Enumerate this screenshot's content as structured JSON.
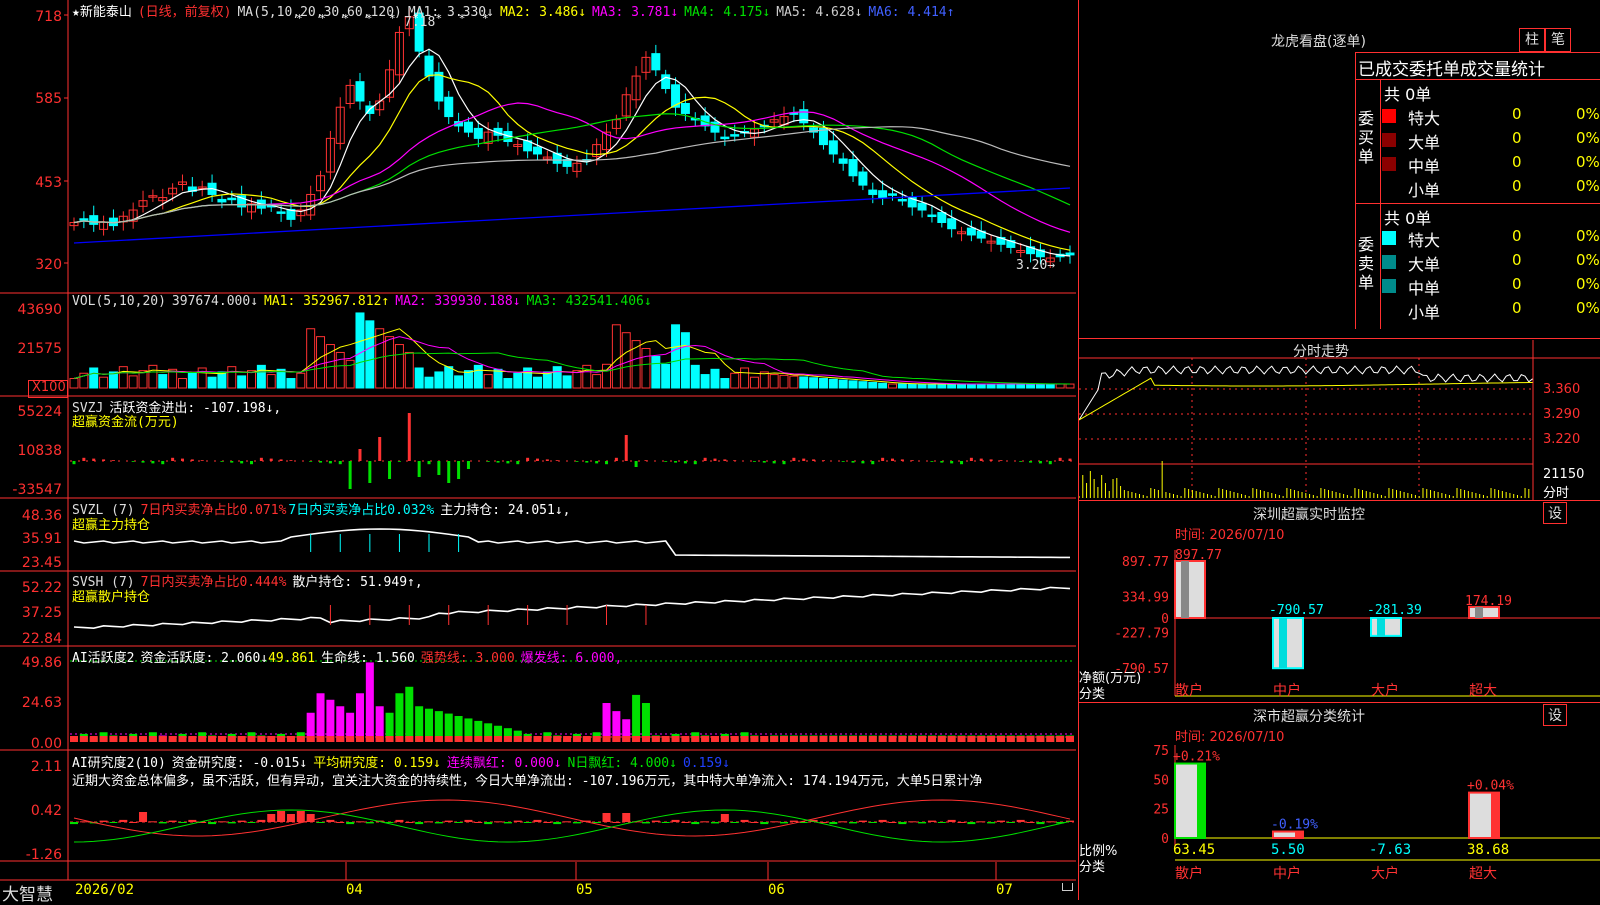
{
  "colors": {
    "up": "#ff3232",
    "down": "#00ffff",
    "grid": "#b00000",
    "axis": "#ff3030",
    "yellow": "#ffff00",
    "magenta": "#ff00ff",
    "green": "#00e000",
    "white": "#ffffff",
    "gray": "#bbbbbb",
    "blue": "#0000ff"
  },
  "main": {
    "title_star": "★新能泰山",
    "title_note": "(日线，前复权)",
    "ma_params": "MA(5,10,20,30,60,120)",
    "ma1": "MA1: 3.330↓",
    "ma2": "MA2: 3.486↓",
    "ma3": "MA3: 3.781↓",
    "ma4": "MA4: 4.175↓",
    "ma5": "MA5: 4.628↓",
    "ma6": "MA6: 4.414↑",
    "yticks": [
      "718",
      "585",
      "453",
      "320"
    ],
    "high_label": "7.18",
    "low_label": "3.20→"
  },
  "vol": {
    "params": "VOL(5,10,20)",
    "value": "397674.000↓",
    "ma1": "MA1: 352967.812↑",
    "ma2": "MA2: 339930.188↓",
    "ma3": "MA3: 432541.406↓",
    "yticks": [
      "43690",
      "21575"
    ],
    "unit": "X100"
  },
  "svzj": {
    "name": "SVZJ",
    "l1": "活跃资金进出: -107.198↓,",
    "l2": "超赢资金流(万元)",
    "yticks": [
      "55224",
      "10838",
      "-33547"
    ]
  },
  "svzl": {
    "name": "SVZL (7)",
    "a": "7日内买卖净占比0.071%",
    "b": "7日内买卖净占比0.032%",
    "c": "主力持仓: 24.051↓,",
    "l2": "超赢主力持仓",
    "yticks": [
      "48.36",
      "35.91",
      "23.45"
    ]
  },
  "svsh": {
    "name": "SVSH (7)",
    "a": "7日内买卖净占比0.444%",
    "c": "散户持仓: 51.949↑,",
    "l2": "超赢散户持仓",
    "yticks": [
      "52.22",
      "37.25",
      "22.84"
    ]
  },
  "ai1": {
    "name": "AI活跃度2",
    "a": "资金活跃度: 2.060↓",
    "b": "49.861",
    "c": "生命线: 1.560",
    "d": "强势线: 3.000",
    "e": "爆发线: 6.000,",
    "yticks": [
      "49.86",
      "24.63",
      "0.00"
    ]
  },
  "ai2": {
    "name": "AI研究度2(10)",
    "a": "资金研究度: -0.015↓",
    "b": "平均研究度: 0.159↓",
    "c": "连续飘红: 0.000↓",
    "d": "N日飘红: 4.000↓",
    "e": "0.159↓",
    "yticks": [
      "2.11",
      "0.42",
      "-1.26"
    ],
    "comment": "近期大资金总体偏多，虽不活跃，但有异动，宜关注大资金的持续性，今日大单净流出: -107.196万元，其中特大单净流入: 174.194万元，大单5日累计净"
  },
  "bottom": {
    "brand": "大智慧",
    "dates": [
      "2026/02",
      "04",
      "05",
      "06",
      "07"
    ]
  },
  "dragon": {
    "title": "龙虎看盘(逐单)",
    "tab1": "柱",
    "tab2": "笔",
    "header": "已成交委托单成交量统计",
    "buy_label": "委买单",
    "sell_label": "委卖单",
    "buy_total": "共 0单",
    "sell_total": "共 0单",
    "rows": [
      {
        "name": "特大",
        "count": "0",
        "pct": "0%"
      },
      {
        "name": "大单",
        "count": "0",
        "pct": "0%"
      },
      {
        "name": "中单",
        "count": "0",
        "pct": "0%"
      },
      {
        "name": "小单",
        "count": "0",
        "pct": "0%"
      }
    ],
    "sell_rows": [
      {
        "name": "特大",
        "count": "0",
        "pct": "0%"
      },
      {
        "name": "大单",
        "count": "0",
        "pct": "0%"
      },
      {
        "name": "中单",
        "count": "0",
        "pct": "0%"
      },
      {
        "name": "小单",
        "count": "0",
        "pct": "0%"
      }
    ]
  },
  "fenshi": {
    "title": "分时走势",
    "ticks": [
      "3.360",
      "3.290",
      "3.220",
      "21150"
    ],
    "unit": "分时"
  },
  "sz_monitor": {
    "title": "深圳超赢实时监控",
    "set": "设",
    "time": "时间: 2026/07/10",
    "yticks": [
      "897.77",
      "334.99",
      "0",
      "-227.79",
      "-790.57"
    ],
    "ylabel": "净额(万元)",
    "xlabel": "分类",
    "cats": [
      "散户",
      "中户",
      "大户",
      "超大"
    ],
    "values": [
      "897.77",
      "-790.57",
      "-281.39",
      "174.19"
    ]
  },
  "sz_class": {
    "title": "深市超赢分类统计",
    "set": "设",
    "time": "时间: 2026/07/10",
    "yticks": [
      "75",
      "50",
      "25",
      "0"
    ],
    "ylabel": "比例%",
    "xlabel": "分类",
    "cats": [
      "散户",
      "中户",
      "大户",
      "超大"
    ],
    "top_labels": [
      "+0.21%",
      "-0.19%",
      "",
      "+0.04%"
    ],
    "bottom_labels": [
      "63.45",
      "5.50",
      "-7.63",
      "38.68"
    ]
  },
  "chart_data": [
    {
      "type": "candlestick",
      "title": "新能泰山 (日线，前复权)",
      "ylim": [
        3.2,
        7.18
      ],
      "ylabel": "price",
      "close": [
        3.85,
        3.9,
        3.82,
        3.86,
        3.8,
        3.95,
        4.05,
        4.2,
        4.28,
        4.25,
        4.4,
        4.5,
        4.35,
        4.42,
        4.3,
        4.18,
        4.22,
        4.1,
        4.15,
        4.08,
        4.1,
        4.0,
        3.9,
        4.05,
        4.3,
        4.6,
        5.2,
        5.7,
        6.05,
        5.8,
        5.6,
        5.8,
        6.3,
        6.9,
        7.15,
        6.6,
        6.2,
        5.8,
        5.55,
        5.4,
        5.3,
        5.2,
        5.3,
        5.25,
        5.15,
        5.1,
        5.0,
        4.95,
        4.9,
        4.8,
        4.75,
        4.8,
        4.85,
        5.1,
        5.3,
        5.5,
        5.9,
        6.2,
        6.5,
        6.3,
        6.0,
        5.7,
        5.6,
        5.5,
        5.4,
        5.3,
        5.2,
        5.25,
        5.3,
        5.35,
        5.4,
        5.5,
        5.55,
        5.6,
        5.45,
        5.3,
        5.1,
        4.95,
        4.8,
        4.6,
        4.45,
        4.3,
        4.25,
        4.3,
        4.2,
        4.1,
        4.05,
        3.95,
        3.85,
        3.75,
        3.7,
        3.65,
        3.6,
        3.55,
        3.5,
        3.45,
        3.4,
        3.35,
        3.3,
        3.28,
        3.3,
        3.33
      ]
    },
    {
      "type": "bar",
      "title": "VOL(5,10,20)",
      "ylim": [
        0,
        43690
      ]
    },
    {
      "type": "bar",
      "title": "超赢资金流(万元)",
      "ylim": [
        -33547,
        55224
      ]
    },
    {
      "type": "line",
      "title": "超赢主力持仓",
      "ylim": [
        23.45,
        48.36
      ]
    },
    {
      "type": "line",
      "title": "超赢散户持仓",
      "ylim": [
        22.84,
        52.22
      ]
    },
    {
      "type": "bar",
      "title": "AI活跃度2",
      "ylim": [
        0,
        49.86
      ]
    },
    {
      "type": "line",
      "title": "AI研究度2(10)",
      "ylim": [
        -1.26,
        2.11
      ]
    },
    {
      "type": "bar",
      "title": "深圳超赢实时监控",
      "categories": [
        "散户",
        "中户",
        "大户",
        "超大"
      ],
      "values": [
        897.77,
        -790.57,
        -281.39,
        174.19
      ],
      "ylim": [
        -790.57,
        897.77
      ],
      "ylabel": "净额(万元)"
    },
    {
      "type": "bar",
      "title": "深市超赢分类统计",
      "categories": [
        "散户",
        "中户",
        "大户",
        "超大"
      ],
      "values": [
        63.45,
        5.5,
        -7.63,
        38.68
      ],
      "ylim": [
        0,
        75
      ],
      "ylabel": "比例%"
    }
  ]
}
